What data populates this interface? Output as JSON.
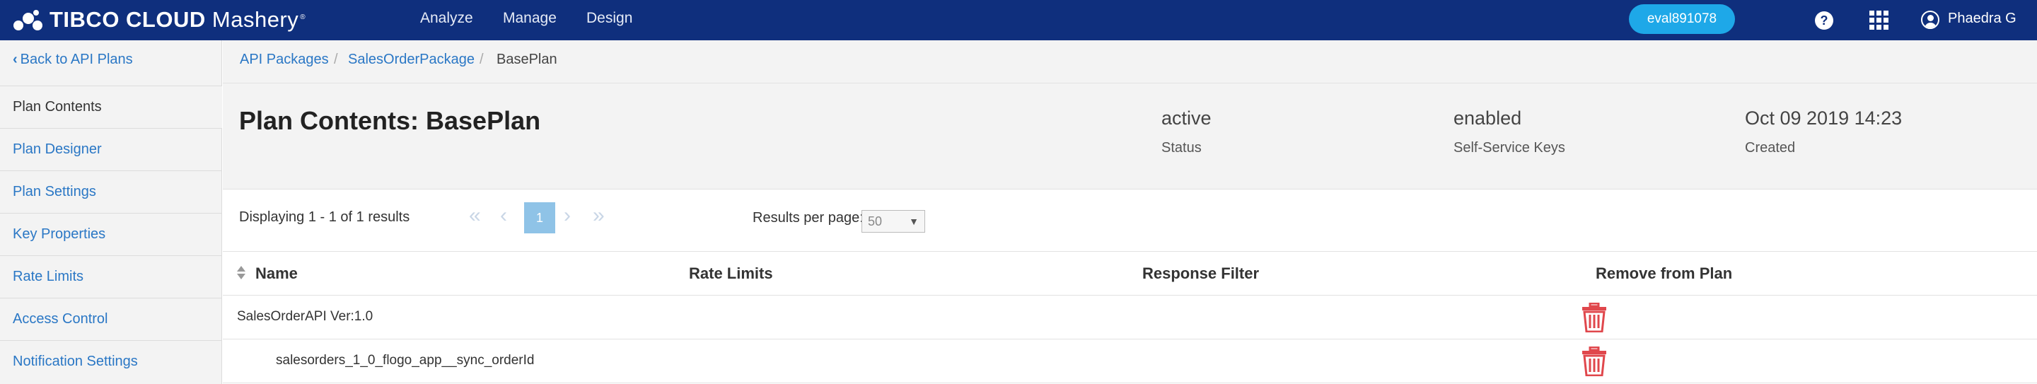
{
  "topbar": {
    "logo": "TIBCO CLOUD Mashery",
    "logo_bold": "TIBCO CLOUD",
    "logo_thin": "Mashery",
    "nav": [
      "Analyze",
      "Manage",
      "Design"
    ],
    "account": "eval891078",
    "help_glyph": "?",
    "user_name": "Phaedra G",
    "colors": {
      "bar": "#0f2f7d",
      "pill": "#1ea8e8"
    }
  },
  "sidebar": {
    "back": "Back to API Plans",
    "items": [
      {
        "label": "Plan Contents",
        "active": true
      },
      {
        "label": "Plan Designer",
        "active": false
      },
      {
        "label": "Plan Settings",
        "active": false
      },
      {
        "label": "Key Properties",
        "active": false
      },
      {
        "label": "Rate Limits",
        "active": false
      },
      {
        "label": "Access Control",
        "active": false
      },
      {
        "label": "Notification Settings",
        "active": false
      }
    ]
  },
  "breadcrumb": {
    "items": [
      "API Packages",
      "SalesOrderPackage",
      "BasePlan"
    ],
    "separator": "/"
  },
  "header": {
    "title": "Plan Contents: BasePlan",
    "status_value": "active",
    "status_label": "Status",
    "keys_value": "enabled",
    "keys_label": "Self-Service Keys",
    "created_value": "Oct 09 2019 14:23",
    "created_label": "Created"
  },
  "pager": {
    "displaying": "Displaying 1 - 1 of 1 results",
    "current_page": "1",
    "rpp_label": "Results per page:",
    "rpp_value": "50"
  },
  "table": {
    "headers": [
      "Name",
      "Rate Limits",
      "Response Filter",
      "Remove from Plan"
    ],
    "rows": [
      {
        "name": "SalesOrderAPI Ver:1.0"
      },
      {
        "name": "salesorders_1_0_flogo_app__sync_orderId"
      }
    ],
    "delete_color": "#e0474c"
  }
}
